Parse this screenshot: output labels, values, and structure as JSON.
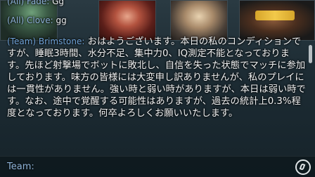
{
  "chat": {
    "lines": [
      {
        "sender": "(All) Fade:",
        "text": " Gg"
      },
      {
        "sender": "(All) Clove:",
        "text": " gg"
      }
    ],
    "main_message": {
      "sender": "(Team) Brimstone:",
      "text": " おはようございます。本日の私のコンディションですが、睡眠3時間、水分不足、集中力0、IQ測定不能となっております。先ほど射撃場でボットに敗北し、自信を失った状態でマッチに参加しております。味方の皆様には大変申し訳ありませんが、私のプレイには一貫性がありません。強い時と弱い時がありますが、本日は弱い時です。なお、途中で覚醒する可能性はありますが、過去の統計上0.3%程度となっております。何卒よろしくお願いいたします。"
    },
    "input": {
      "channel_label": "Team:",
      "value": "",
      "placeholder": ""
    }
  },
  "icons": {
    "input_action": "chat-channel-icon"
  },
  "colors": {
    "team_sender": "#6fa3d8",
    "all_sender": "#8fb4d9",
    "message_text": "#f0f2f3"
  }
}
